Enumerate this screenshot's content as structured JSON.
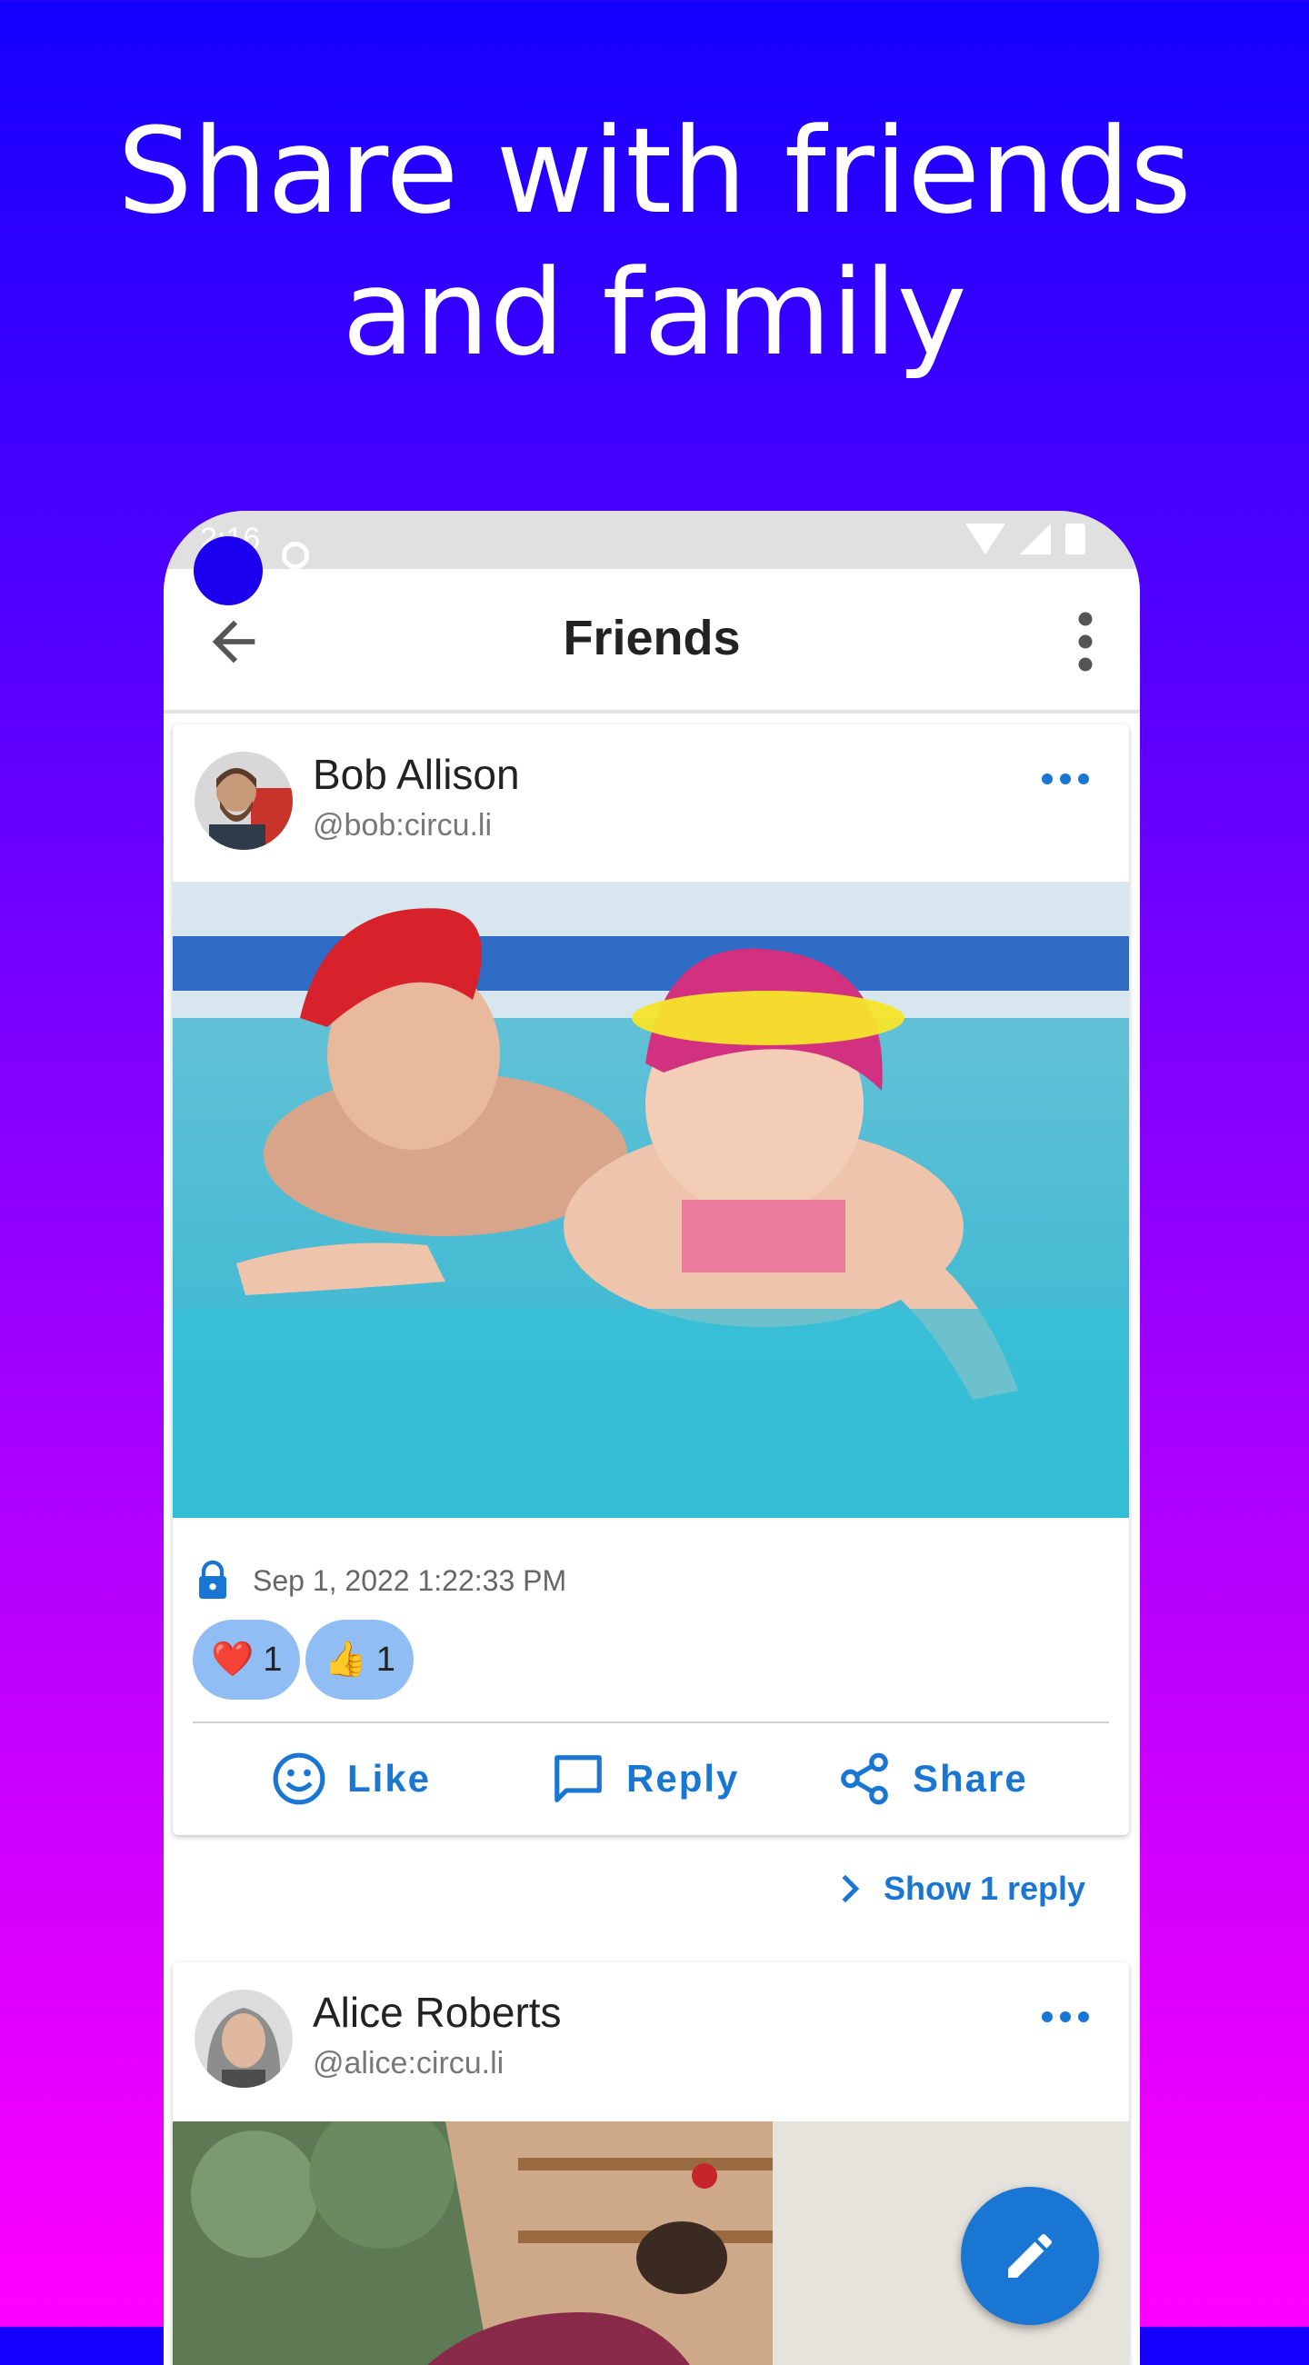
{
  "headline": {
    "line1": "Share with friends",
    "line2": "and family"
  },
  "status_bar": {
    "time": "2:16"
  },
  "app_bar": {
    "title": "Friends",
    "back_icon": "arrow-back-icon",
    "menu_icon": "more-vert-icon"
  },
  "posts": [
    {
      "author_name": "Bob Allison",
      "author_handle": "@bob:circu.li",
      "menu_icon": "more-horiz-icon",
      "image_subject": "mother and baby swimming in pool",
      "privacy_icon": "lock-icon",
      "timestamp": "Sep 1, 2022 1:22:33 PM",
      "reactions": [
        {
          "emoji": "❤️",
          "count": "1"
        },
        {
          "emoji": "👍",
          "count": "1"
        }
      ],
      "actions": {
        "like": "Like",
        "reply": "Reply",
        "share": "Share"
      },
      "show_replies": "Show 1 reply"
    },
    {
      "author_name": "Alice Roberts",
      "author_handle": "@alice:circu.li",
      "menu_icon": "more-horiz-icon",
      "image_subject": "woman on a patio with trees"
    }
  ],
  "fab": {
    "icon": "pencil-edit-icon"
  },
  "colors": {
    "accent": "#1976d2",
    "chip": "#90bef4",
    "gradient_top": "#1400ff",
    "gradient_bottom": "#ff00ff"
  }
}
